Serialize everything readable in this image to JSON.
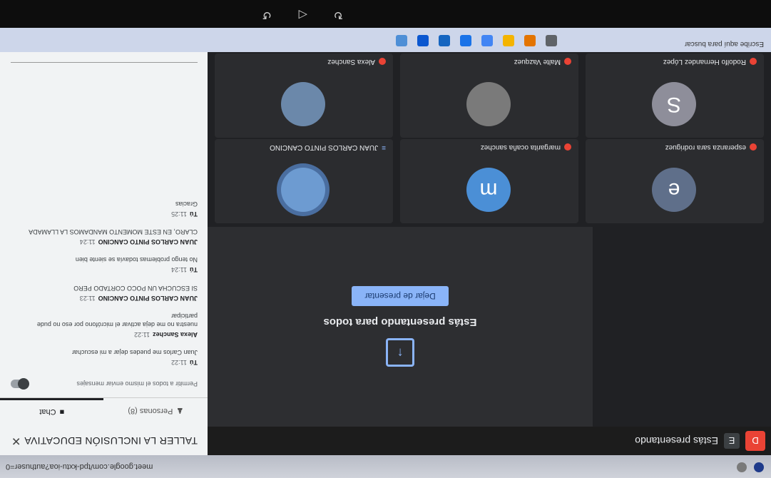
{
  "browser": {
    "url": "meet.google.com/tpd-kxtu-ioa?authuser=0"
  },
  "meet": {
    "presenting_badge_letter": "E",
    "presenting_badge_text": "Estás presentando",
    "record_letter": "D",
    "presenting_card": {
      "title": "Estás presentando para todos",
      "stop_button": "Dejar de presentar",
      "icon": "present-screen-icon"
    },
    "tiles": [
      {
        "name": "esperanza sara rodriguez",
        "initial": "e",
        "color": "#5f6f8a"
      },
      {
        "name": "margarita ocaña sanchez",
        "initial": "m",
        "color": "#4b8fd6"
      },
      {
        "name": "JUAN CARLOS PINTO CANCINO",
        "initial": "",
        "color": "#6d9bd1",
        "speaking": true
      },
      {
        "name": "Rodolfo Hernandez López",
        "initial": "S",
        "color": "#8e8e9a"
      },
      {
        "name": "Malte Vazquez",
        "initial": "",
        "color": "#7a7a7a"
      },
      {
        "name": "Alexa Sanchez",
        "initial": "",
        "color": "#6b88aa"
      }
    ]
  },
  "side_panel": {
    "title": "TALLER LA INCLUSIÓN EDUCATIVA",
    "tab_people": "Personas (8)",
    "tab_chat": "Chat",
    "toggle_label": "Permitir a todos el mismo enviar mensajes",
    "messages": [
      {
        "who": "Tú",
        "time": "11:22",
        "text": "Juan Carlos me puedes dejar a mi escuchar"
      },
      {
        "who": "Alexa Sanchez",
        "time": "11:22",
        "text": "nuestra no me deja activar el micrófono por eso no pude participar"
      },
      {
        "who": "JUAN CARLOS PINTO CANCINO",
        "time": "11:23",
        "text": "SI ESCUCHA UN POCO CORTADO PERO"
      },
      {
        "who": "Tú",
        "time": "11:24",
        "text": "No tengo problemas todavía se siente bien"
      },
      {
        "who": "JUAN CARLOS PINTO CANCINO",
        "time": "11:24",
        "text": "CLARO, EN ESTE MOMENTO MANDAMOS LA LLAMADA"
      },
      {
        "who": "Tú",
        "time": "11:25",
        "text": "Gracias"
      }
    ],
    "compose_placeholder": ""
  },
  "taskbar": {
    "search_text": "Escribe aquí para buscar"
  }
}
